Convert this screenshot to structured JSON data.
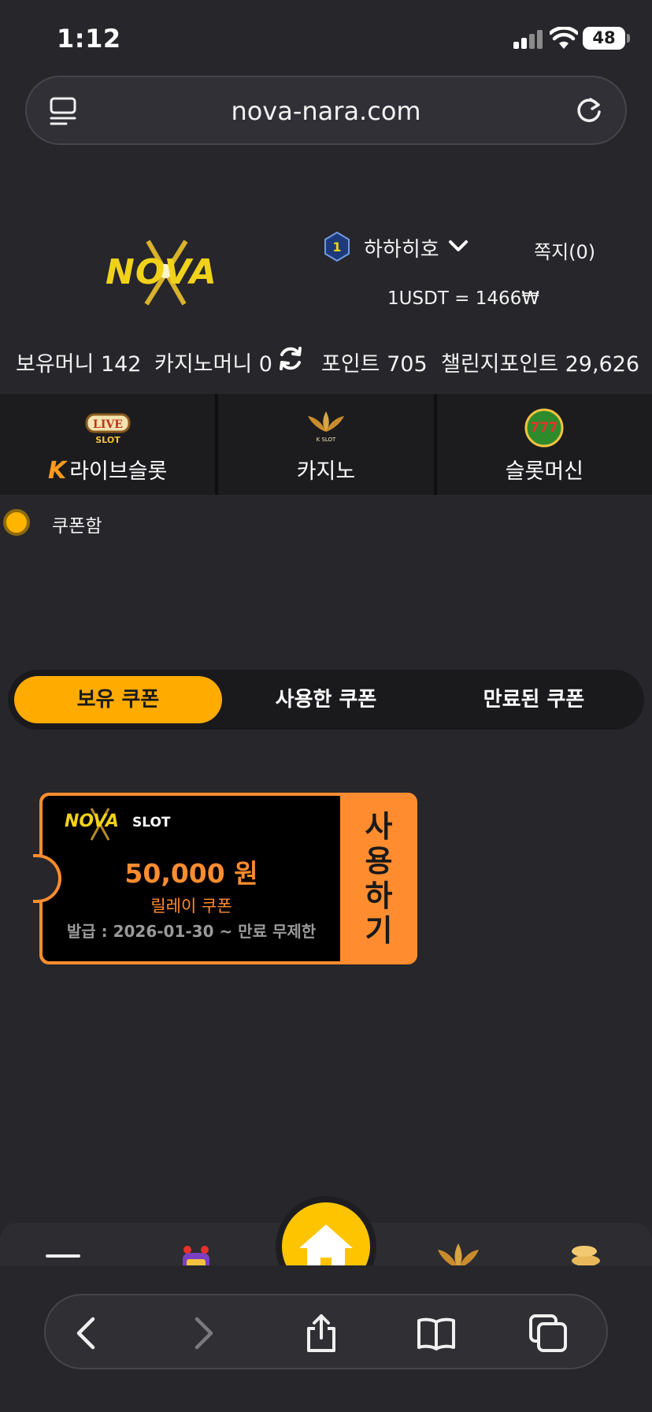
{
  "status_bar": {
    "time": "1:12",
    "battery": "48"
  },
  "browser": {
    "url": "nova-nara.com"
  },
  "header": {
    "logo_text": "NOVA",
    "username": "하하히호",
    "user_level": "1",
    "messages": "쪽지(0)",
    "exchange_rate": "1USDT = 1466₩"
  },
  "balances": {
    "holding": "보유머니 142",
    "casino": "카지노머니 0",
    "points": "포인트 705",
    "challenge_points": "챌린지포인트 29,626"
  },
  "games": [
    {
      "label": "라이브슬롯",
      "icon": "live-slot-icon",
      "icon_text": "LIVE"
    },
    {
      "label": "카지노",
      "icon": "k-slot-icon",
      "icon_text": "K SLOT"
    },
    {
      "label": "슬롯머신",
      "icon": "777-slots-icon",
      "icon_text": "777"
    }
  ],
  "coupon_box": {
    "title": "쿠폰함"
  },
  "tabs": [
    "보유 쿠폰",
    "사용한 쿠폰",
    "만료된 쿠폰"
  ],
  "active_tab": 0,
  "coupons": [
    {
      "brand": "NOVA",
      "brand_sub": "SLOT",
      "amount": "50,000 원",
      "type": "릴레이 쿠폰",
      "dates": "발급 : 2026-01-30 ~ 만료 무제한",
      "use_label": [
        "사",
        "용",
        "하",
        "기"
      ]
    }
  ],
  "bottom_nav": [
    "menu-icon",
    "slot-machine-icon",
    "home-icon",
    "k-slot-icon",
    "coins-icon"
  ],
  "colors": {
    "accent": "#ffab00",
    "coupon": "#ff8d2f",
    "background": "#26262b"
  }
}
